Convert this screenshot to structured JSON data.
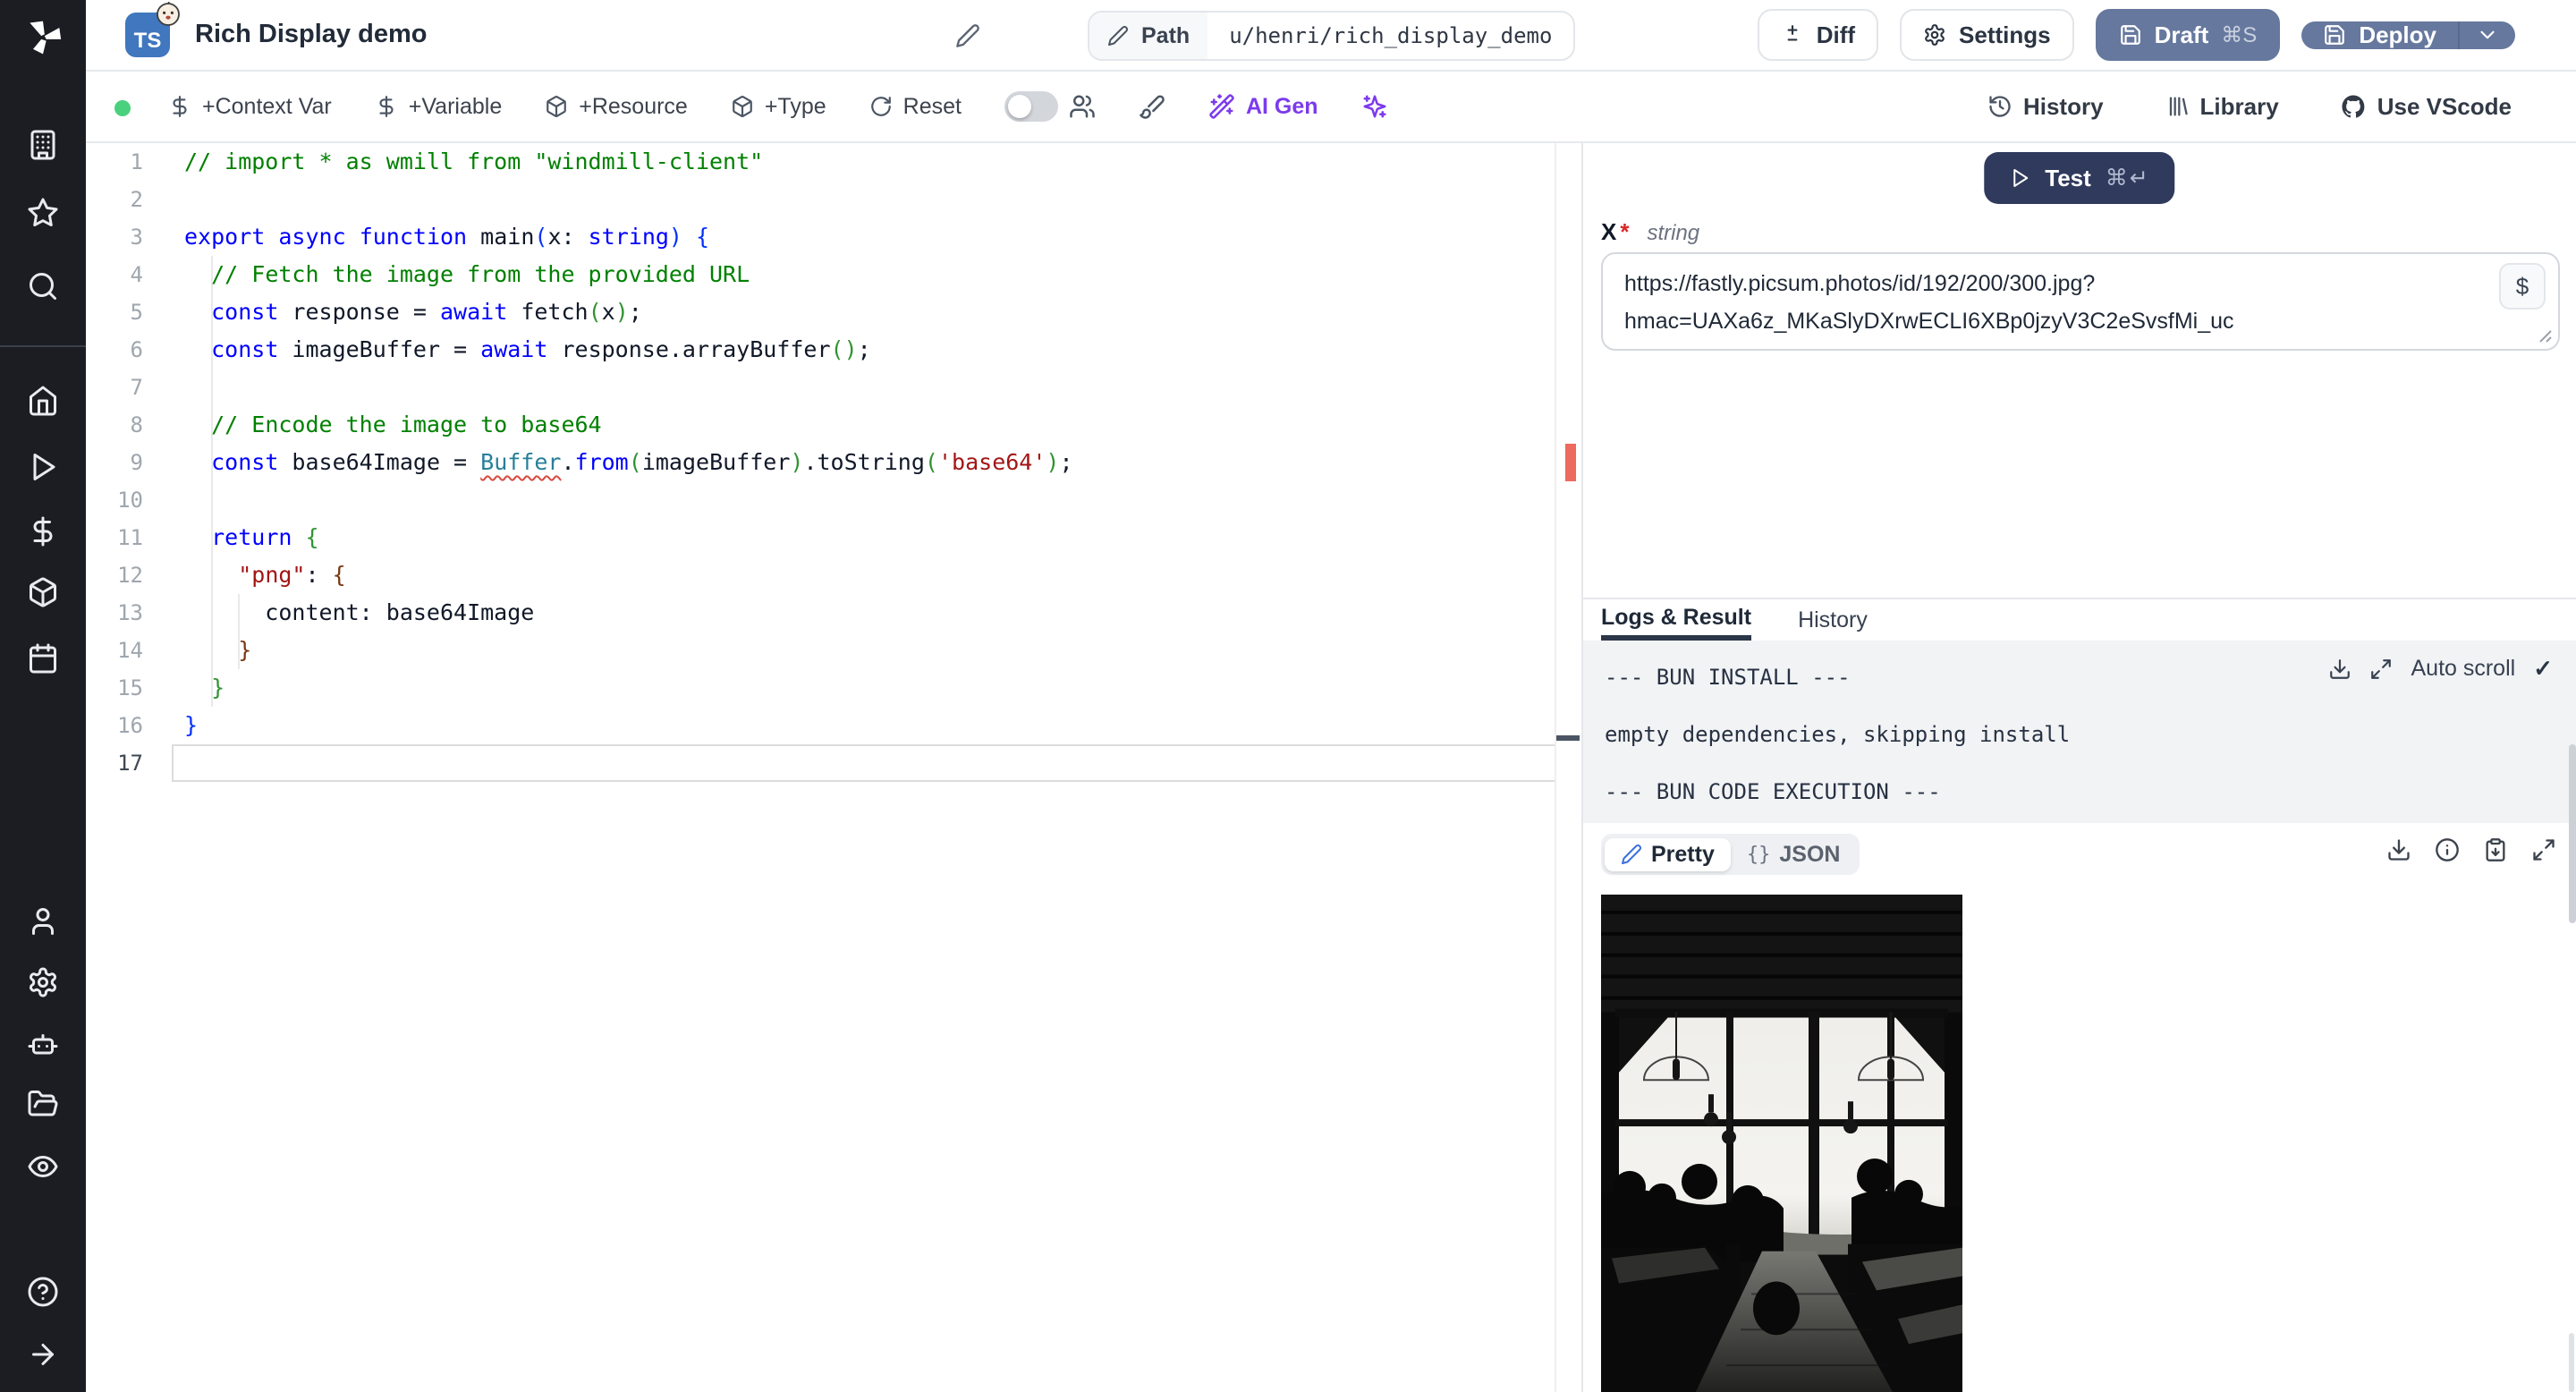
{
  "app": {
    "name": "Windmill script editor"
  },
  "colors": {
    "sidebar_bg": "#1b1d23",
    "accent_slate_button": "#66789e",
    "test_button": "#2f3a5c",
    "ai_purple": "#7c3aed",
    "status_green": "#49d17d",
    "error_marker": "#ed6a5e",
    "log_bg": "#f2f3f5",
    "ts_badge": "#4077be"
  },
  "sidebar": {
    "icons": [
      "windmill-logo",
      "building",
      "star",
      "search",
      "home",
      "play",
      "dollar",
      "package",
      "calendar",
      "user",
      "gear",
      "robot",
      "folder-open",
      "eye",
      "help",
      "arrow-right"
    ]
  },
  "header": {
    "badge": "TS",
    "title": "Rich Display demo",
    "path_label": "Path",
    "path_value": "u/henri/rich_display_demo",
    "diff": "Diff",
    "settings": "Settings",
    "draft": "Draft",
    "draft_shortcut": "⌘S",
    "deploy": "Deploy"
  },
  "toolbar": {
    "context_var": "+Context Var",
    "variable": "+Variable",
    "resource": "+Resource",
    "type": "+Type",
    "reset": "Reset",
    "ai_gen": "AI Gen",
    "history": "History",
    "library": "Library",
    "vscode": "Use VScode"
  },
  "editor": {
    "language": "typescript",
    "lines": [
      [
        [
          "c",
          "// import * as wmill from \"windmill-client\""
        ]
      ],
      [],
      [
        [
          "k",
          "export"
        ],
        [
          "p",
          " "
        ],
        [
          "k",
          "async"
        ],
        [
          "p",
          " "
        ],
        [
          "k",
          "function"
        ],
        [
          "p",
          " main"
        ],
        [
          "b1",
          "("
        ],
        [
          "p",
          "x: "
        ],
        [
          "k",
          "string"
        ],
        [
          "b1",
          ")"
        ],
        [
          "p",
          " "
        ],
        [
          "b1",
          "{"
        ]
      ],
      [
        [
          "p",
          "  "
        ],
        [
          "c",
          "// Fetch the image from the provided URL"
        ]
      ],
      [
        [
          "p",
          "  "
        ],
        [
          "k",
          "const"
        ],
        [
          "p",
          " response = "
        ],
        [
          "k",
          "await"
        ],
        [
          "p",
          " fetch"
        ],
        [
          "b2",
          "("
        ],
        [
          "p",
          "x"
        ],
        [
          "b2",
          ")"
        ],
        [
          "p",
          ";"
        ]
      ],
      [
        [
          "p",
          "  "
        ],
        [
          "k",
          "const"
        ],
        [
          "p",
          " imageBuffer = "
        ],
        [
          "k",
          "await"
        ],
        [
          "p",
          " response.arrayBuffer"
        ],
        [
          "b2",
          "("
        ],
        [
          "b2",
          ")"
        ],
        [
          "p",
          ";"
        ]
      ],
      [],
      [
        [
          "p",
          "  "
        ],
        [
          "c",
          "// Encode the image to base64"
        ]
      ],
      [
        [
          "p",
          "  "
        ],
        [
          "k",
          "const"
        ],
        [
          "p",
          " base64Image = "
        ],
        [
          "terr",
          "Buffer"
        ],
        [
          "p",
          "."
        ],
        [
          "k",
          "from"
        ],
        [
          "b2",
          "("
        ],
        [
          "p",
          "imageBuffer"
        ],
        [
          "b2",
          ")"
        ],
        [
          "p",
          ".toString"
        ],
        [
          "b2",
          "("
        ],
        [
          "s",
          "'base64'"
        ],
        [
          "b2",
          ")"
        ],
        [
          "p",
          ";"
        ]
      ],
      [],
      [
        [
          "p",
          "  "
        ],
        [
          "k",
          "return"
        ],
        [
          "p",
          " "
        ],
        [
          "b2",
          "{"
        ]
      ],
      [
        [
          "p",
          "    "
        ],
        [
          "s",
          "\"png\""
        ],
        [
          "p",
          ": "
        ],
        [
          "b3",
          "{"
        ]
      ],
      [
        [
          "p",
          "      content: base64Image"
        ]
      ],
      [
        [
          "p",
          "    "
        ],
        [
          "b3",
          "}"
        ]
      ],
      [
        [
          "p",
          "  "
        ],
        [
          "b2",
          "}"
        ]
      ],
      [
        [
          "b1",
          "}"
        ]
      ],
      []
    ],
    "active_line": 17
  },
  "run_panel": {
    "test_label": "Test",
    "test_shortcut": "⌘↵",
    "arg_name": "X",
    "required_mark": "*",
    "arg_type": "string",
    "value": "https://fastly.picsum.photos/id/192/200/300.jpg?hmac=UAXa6z_MKaSlyDXrwECLI6XBp0jzyV3C2eSvsfMi_uc",
    "value_lines": [
      "https://fastly.picsum.photos/id/192/200/300.jpg?",
      "hmac=UAXa6z_MKaSlyDXrwECLI6XBp0jzyV3C2eSvsfMi_uc"
    ],
    "dollar": "$"
  },
  "logs": {
    "tabs": [
      "Logs & Result",
      "History"
    ],
    "active_tab": "Logs & Result",
    "lines": [
      "--- BUN INSTALL ---",
      "empty dependencies, skipping install",
      "--- BUN CODE EXECUTION ---"
    ],
    "auto_scroll_label": "Auto scroll",
    "check": "✓"
  },
  "result": {
    "pretty_label": "Pretty",
    "json_braces": "{}",
    "json_label": "JSON",
    "image_description": "black-and-white photo: silhouettes of people at cafe tables in front of large bright windows with pendant lamps"
  }
}
